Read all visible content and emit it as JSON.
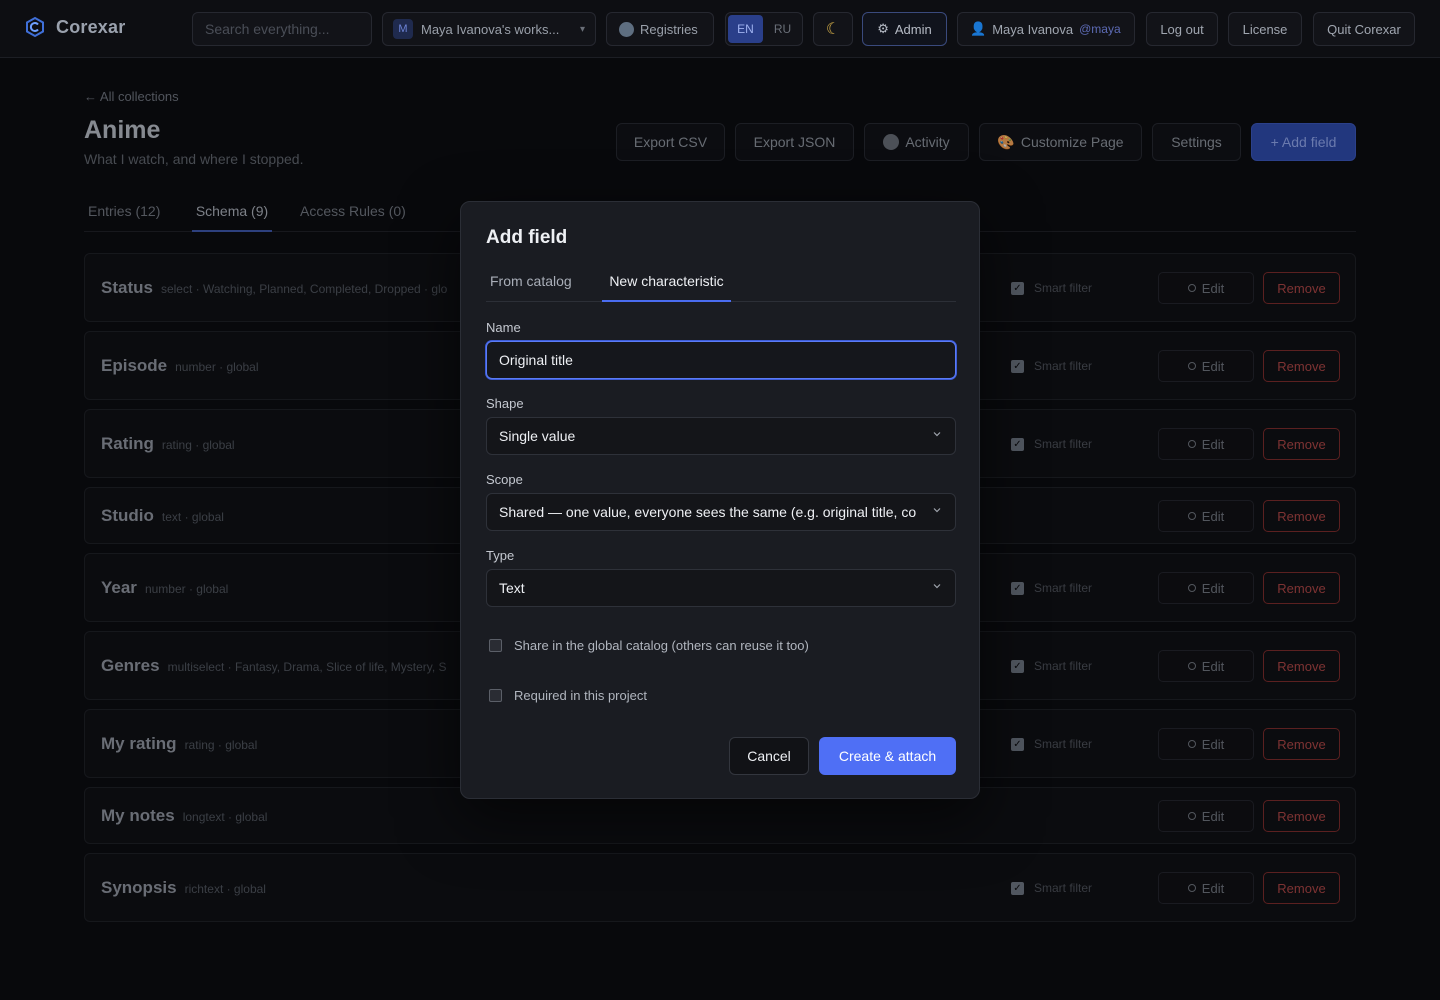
{
  "app": {
    "name": "Corexar",
    "search_placeholder": "Search everything...",
    "workspace_badge": "M",
    "workspace_name": "Maya Ivanova's works...",
    "registries": "Registries",
    "lang_en": "EN",
    "lang_ru": "RU",
    "theme_icon": "☾",
    "admin": "Admin",
    "user_name": "Maya Ivanova",
    "user_handle": "@maya",
    "logout": "Log out",
    "license": "License",
    "quit": "Quit Corexar"
  },
  "page": {
    "back": "← All collections",
    "title": "Anime",
    "subtitle": "What I watch, and where I stopped.",
    "actions": {
      "export_csv": "Export CSV",
      "export_json": "Export JSON",
      "activity": "Activity",
      "customize": "Customize Page",
      "settings": "Settings",
      "add_field": "+ Add field"
    },
    "tabs": [
      "Entries (12)",
      "Schema (9)",
      "Access Rules (0)"
    ]
  },
  "fields": [
    {
      "name": "Status",
      "meta": "select · Watching, Planned, Completed, Dropped · glo",
      "smart_filter": true
    },
    {
      "name": "Episode",
      "meta": "number · global",
      "smart_filter": true
    },
    {
      "name": "Rating",
      "meta": "rating · global",
      "smart_filter": true
    },
    {
      "name": "Studio",
      "meta": "text · global",
      "smart_filter": false
    },
    {
      "name": "Year",
      "meta": "number · global",
      "smart_filter": true
    },
    {
      "name": "Genres",
      "meta": "multiselect · Fantasy, Drama, Slice of life, Mystery, S",
      "smart_filter": true
    },
    {
      "name": "My rating",
      "meta": "rating · global",
      "smart_filter": true
    },
    {
      "name": "My notes",
      "meta": "longtext · global",
      "smart_filter": false
    },
    {
      "name": "Synopsis",
      "meta": "richtext · global",
      "smart_filter": true
    }
  ],
  "row_labels": {
    "smart_filter": "Smart filter",
    "edit": "Edit",
    "remove": "Remove"
  },
  "modal": {
    "title": "Add field",
    "tab_catalog": "From catalog",
    "tab_new": "New characteristic",
    "name_label": "Name",
    "name_value": "Original title",
    "shape_label": "Shape",
    "shape_value": "Single value",
    "scope_label": "Scope",
    "scope_value": "Shared — one value, everyone sees the same (e.g. original title, co",
    "type_label": "Type",
    "type_value": "Text",
    "share_label": "Share in the global catalog (others can reuse it too)",
    "required_label": "Required in this project",
    "cancel": "Cancel",
    "create": "Create & attach"
  }
}
